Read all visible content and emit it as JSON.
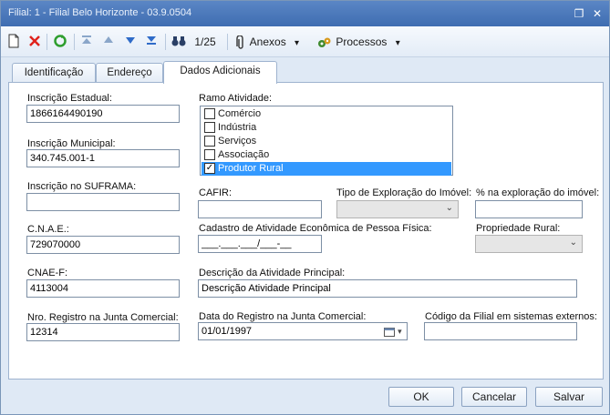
{
  "window": {
    "title": "Filial: 1 - Filial Belo Horizonte  - 03.9.0504",
    "restore_glyph": "❐",
    "close_glyph": "✕"
  },
  "toolbar": {
    "record_position": "1/25",
    "anexos_label": "Anexos",
    "processos_label": "Processos",
    "dropdown_glyph": "▾"
  },
  "tabs": [
    "Identificação",
    "Endereço",
    "Dados Adicionais"
  ],
  "form": {
    "inscricao_estadual": {
      "label": "Inscrição Estadual:",
      "value": "1866164490190"
    },
    "inscricao_municipal": {
      "label": "Inscrição Municipal:",
      "value": "340.745.001-1"
    },
    "inscricao_suframa": {
      "label": "Inscrição no SUFRAMA:",
      "value": ""
    },
    "cnae": {
      "label": "C.N.A.E.:",
      "value": "729070000"
    },
    "cnae_f": {
      "label": "CNAE-F:",
      "value": "4113004"
    },
    "nro_registro": {
      "label": "Nro. Registro na Junta Comercial:",
      "value": "12314"
    },
    "ramo_atividade": {
      "label": "Ramo Atividade:",
      "items": [
        {
          "label": "Comércio",
          "checked": false
        },
        {
          "label": "Indústria",
          "checked": false
        },
        {
          "label": "Serviços",
          "checked": false
        },
        {
          "label": "Associação",
          "checked": false
        },
        {
          "label": "Produtor Rural",
          "checked": true
        }
      ],
      "check_glyph": "✓"
    },
    "cafir": {
      "label": "CAFIR:",
      "value": ""
    },
    "tipo_exploracao": {
      "label": "Tipo de Exploração do Imóvel:",
      "value": ""
    },
    "pct_exploracao": {
      "label": "% na exploração do imóvel:",
      "value": ""
    },
    "cadastro_atividade": {
      "label": "Cadastro de Atividade Econômica de Pessoa Física:",
      "value": "___.___.___/___-__"
    },
    "propriedade_rural": {
      "label": "Propriedade Rural:",
      "value": ""
    },
    "descricao_atividade": {
      "label": "Descrição da Atividade Principal:",
      "value": "Descrição Atividade Principal"
    },
    "data_registro": {
      "label": "Data do Registro na Junta Comercial:",
      "value": "01/01/1997"
    },
    "codigo_filial": {
      "label": "Código da Filial em sistemas externos:",
      "value": ""
    }
  },
  "buttons": {
    "ok": "OK",
    "cancel": "Cancelar",
    "save": "Salvar"
  },
  "colors": {
    "titlebar": "#4a78bb",
    "selection": "#3399ff",
    "chrome": "#dfe9f5"
  }
}
